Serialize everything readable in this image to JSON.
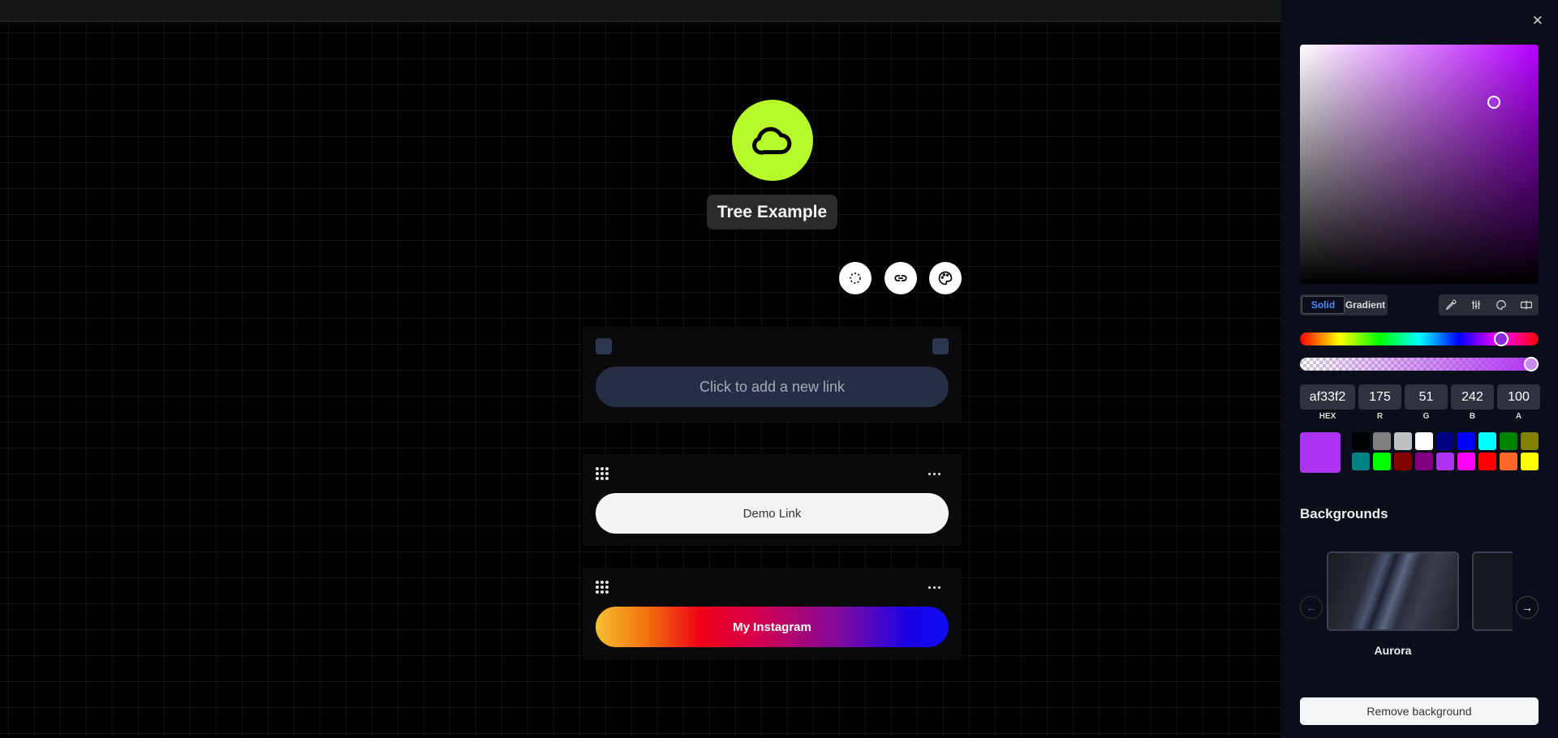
{
  "profile": {
    "name": "Tree Example",
    "avatar_color": "#b6fa2c"
  },
  "toolbar": {
    "icons": [
      "rotate-icon",
      "link-icon",
      "palette-icon"
    ]
  },
  "links": {
    "add_label": "Click to add a new link",
    "items": [
      {
        "label": "Demo Link"
      },
      {
        "label": "My Instagram"
      }
    ]
  },
  "color_picker": {
    "modes": {
      "solid": "Solid",
      "gradient": "Gradient"
    },
    "active_mode": "Solid",
    "hex": "af33f2",
    "r": "175",
    "g": "51",
    "b": "242",
    "a": "100",
    "labels": {
      "hex": "HEX",
      "r": "R",
      "g": "G",
      "b": "B",
      "a": "A"
    },
    "current_color": "#af33f2",
    "swatches": [
      "#000000",
      "#808080",
      "#c0c0c0",
      "#ffffff",
      "#000080",
      "#0000ff",
      "#00ffff",
      "#008000",
      "#808000",
      "#008080",
      "#00ff00",
      "#800000",
      "#800080",
      "#af33f2",
      "#ff00ff",
      "#ff0000",
      "#ff6a28",
      "#ffff00"
    ]
  },
  "backgrounds": {
    "title": "Backgrounds",
    "items": [
      {
        "label": "Aurora"
      }
    ],
    "remove_label": "Remove background"
  }
}
